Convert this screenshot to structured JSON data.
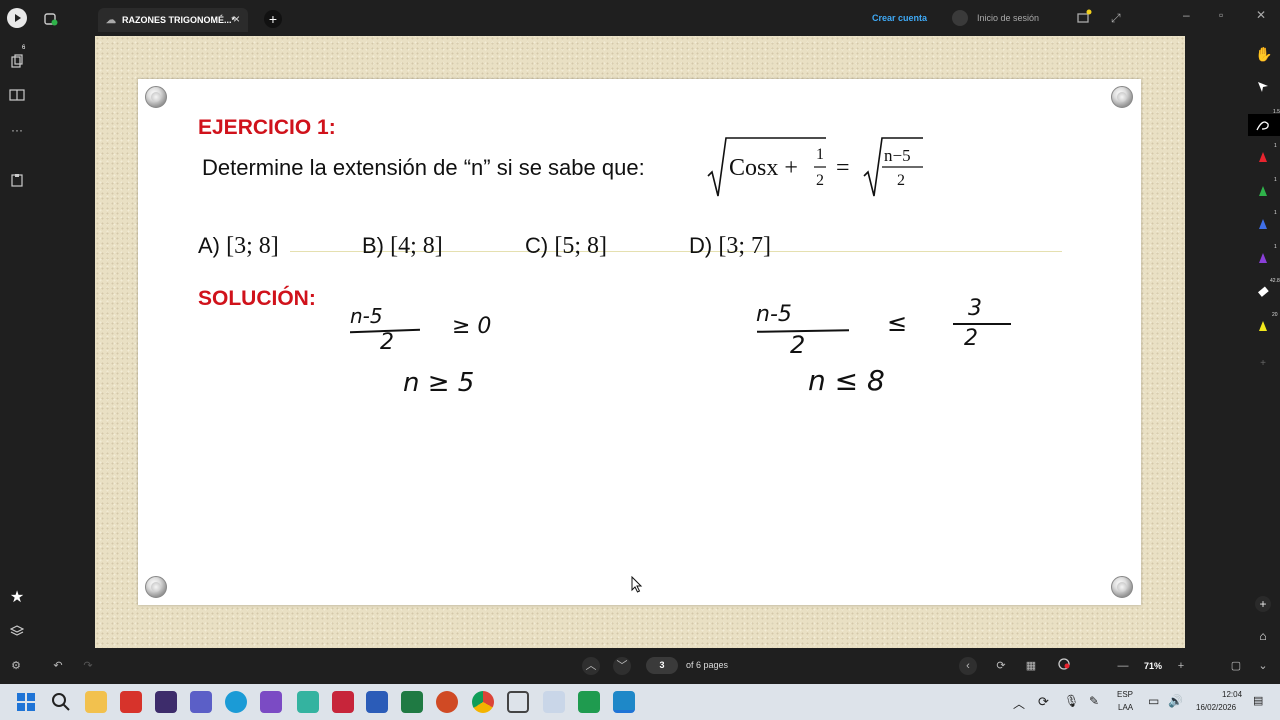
{
  "app": {
    "tab_title": "RAZONES TRIGONOMÉ...*",
    "create_account": "Crear cuenta",
    "sign_in": "Inicio de sesión",
    "accent_color": "#3fa9f5"
  },
  "left_sidebar": {
    "badges": [
      "6"
    ]
  },
  "worksheet": {
    "exercise_title": "EJERCICIO 1:",
    "problem_text": "Determine la extensión de “n” si se sabe que:",
    "eq_left": "Cosx +",
    "frac1_num": "1",
    "frac1_den": "2",
    "eq_sign": "=",
    "frac2_num": "n−5",
    "frac2_den": "2",
    "options": [
      {
        "letter": "A)",
        "interval": "[3; 8]"
      },
      {
        "letter": "B)",
        "interval": "[4; 8]"
      },
      {
        "letter": "C)",
        "interval": "[5; 8]"
      },
      {
        "letter": "D)",
        "interval": "[3; 7]"
      }
    ],
    "solution_title": "SOLUCIÓN:",
    "handwriting": {
      "left_ineq1_num": "n-5",
      "left_ineq1_den": "2",
      "left_ineq1_rel": "≥ 0",
      "left_ineq2": "n ≥ 5",
      "right_ineq1_num": "n-5",
      "right_ineq1_den": "2",
      "right_ineq1_rel": "≤",
      "right_ineq1_rhs_num": "3",
      "right_ineq1_rhs_den": "2",
      "right_ineq2": "n ≤ 8"
    }
  },
  "right_toolbar": {
    "tool_sizes": [
      "1.5",
      "1",
      "1",
      "1",
      "1",
      "42.8",
      "20"
    ],
    "pen_colors": [
      "#e8242e",
      "#2fb24a",
      "#3f6fe8",
      "#8a3fd8",
      "#f2e81c"
    ]
  },
  "bottom_bar": {
    "current_page": "3",
    "page_total_text": "of 6 pages",
    "zoom": "71%"
  },
  "taskbar": {
    "lang_top": "ESP",
    "lang_bottom": "LAA",
    "time": "12:04",
    "date": "16/02/2026"
  }
}
